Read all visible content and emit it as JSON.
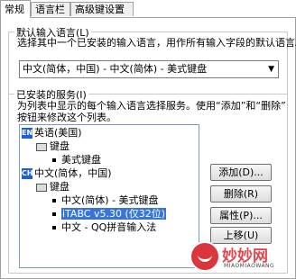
{
  "tabs": [
    "常规",
    "语言栏",
    "高级键设置"
  ],
  "default_group": {
    "title": "默认输入语言(L)",
    "description": "选择其中一个已安装的输入语言，用作所有输入字段的默认语言。",
    "selected": "中文(简体，中国) - 中文(简体) - 美式键盘"
  },
  "services_group": {
    "title": "已安装的服务(I)",
    "description_line1": "为列表中显示的每个输入语言选择服务。使用“添加”和“删除”",
    "description_line2": "按钮来修改这个列表。"
  },
  "tree": {
    "en_badge": "EN",
    "en_label": "英语(美国)",
    "en_keyboard": "键盘",
    "en_layout": "美式键盘",
    "ch_badge": "CH",
    "ch_label": "中文(简体，中国)",
    "ch_keyboard": "键盘",
    "ch_items": [
      "中文(简体) - 美式键盘",
      "iTABC v5.30 (仅32位)",
      "中文 - QQ拼音输入法"
    ]
  },
  "buttons": {
    "add": "添加(D)...",
    "remove": "删除(R)",
    "properties": "属性(P)...",
    "move_up": "上移(U)"
  },
  "watermark": {
    "text": "妙妙网",
    "sub": "MIAOMIAOWANG"
  }
}
